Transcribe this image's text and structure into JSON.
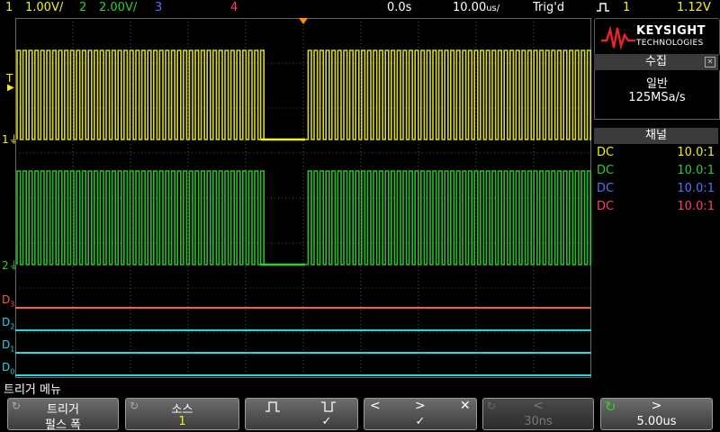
{
  "topbar": {
    "ch1_num": "1",
    "ch1_scale": "1.00V/",
    "ch2_num": "2",
    "ch2_scale": "2.00V/",
    "ch3_num": "3",
    "ch4_num": "4",
    "time_pos": "0.0s",
    "timebase": "10.00",
    "timebase_unit": "us/",
    "trigger_status": "Trig'd",
    "trigger_source": "1",
    "trigger_level": "1.12V"
  },
  "colors": {
    "ch1": "#f2f21a",
    "ch2": "#2cd22c",
    "ch3": "#5570ff",
    "ch4": "#ff3c7a",
    "d3": "#ff5a3c",
    "digital": "#22d8e8",
    "trigger_marker": "#ff8c1a"
  },
  "logo": {
    "brand": "KEYSIGHT",
    "subtitle": "TECHNOLOGIES"
  },
  "acquire": {
    "title": "수집",
    "mode": "일반",
    "rate": "125MSa/s"
  },
  "channels": {
    "title": "채널",
    "rows": [
      {
        "coupling": "DC",
        "probe": "10.0:1"
      },
      {
        "coupling": "DC",
        "probe": "10.0:1"
      },
      {
        "coupling": "DC",
        "probe": "10.0:1"
      },
      {
        "coupling": "DC",
        "probe": "10.0:1"
      }
    ]
  },
  "markers": {
    "trigger_T": "T",
    "ch1": "1",
    "ch2": "2",
    "d3": "D3",
    "d2": "D2",
    "d1": "D1",
    "d0": "D0"
  },
  "softkeys": {
    "menu_title": "트리거 메뉴",
    "k1_label": "트리거",
    "k1_value": "펄스 폭",
    "k2_label": "소스",
    "k2_value": "1",
    "k3_value": "✓",
    "k4_left": "<",
    "k4_right": ">",
    "k4_x": "✕",
    "k4_value": "✓",
    "k5_label": "<",
    "k5_value": "30ns",
    "k6_label": ">",
    "k6_value": "5.00us"
  },
  "waveform": {
    "ch1_gap_start_fraction": 0.426,
    "ch1_gap_end_fraction": 0.503,
    "pulse_count_visible": 96
  }
}
